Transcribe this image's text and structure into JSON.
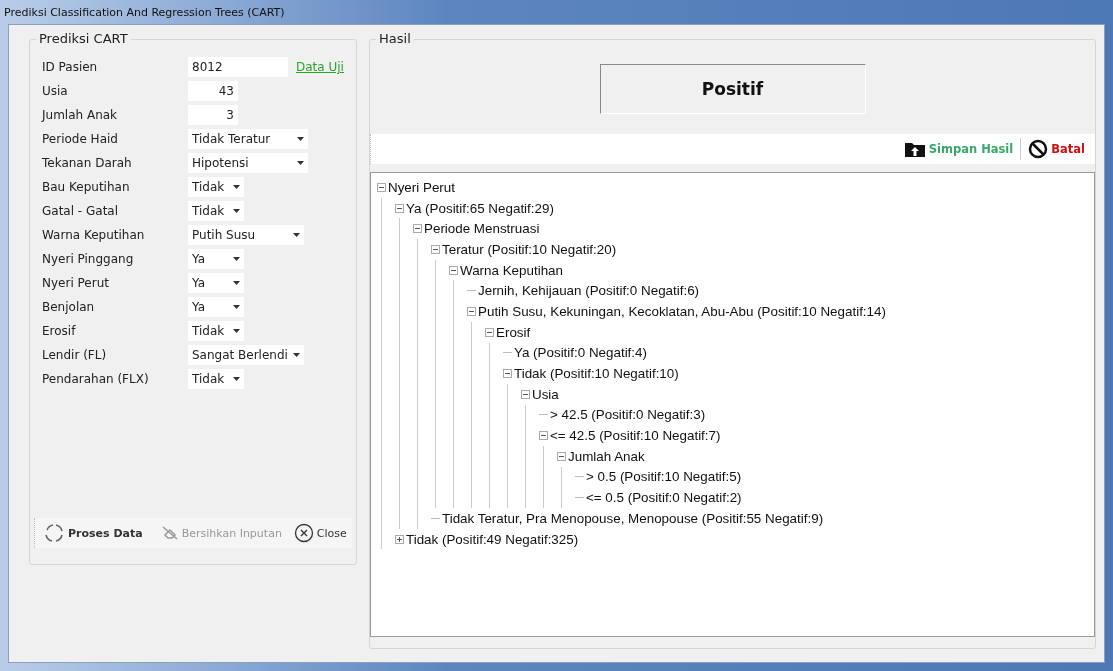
{
  "window": {
    "title": "Prediksi Classification And Regression Trees (CART)"
  },
  "form": {
    "title": "Prediksi CART",
    "fields": [
      {
        "label": "ID Pasien",
        "kind": "text",
        "value": "8012",
        "link": "Data Uji"
      },
      {
        "label": "Usia",
        "kind": "number",
        "value": "43"
      },
      {
        "label": "Jumlah Anak",
        "kind": "number",
        "value": "3"
      },
      {
        "label": "Periode Haid",
        "kind": "dropdown",
        "value": "Tidak Teratur"
      },
      {
        "label": "Tekanan Darah",
        "kind": "dropdown",
        "value": "Hipotensi"
      },
      {
        "label": "Bau Keputihan",
        "kind": "dropdown",
        "value": "Tidak"
      },
      {
        "label": "Gatal - Gatal",
        "kind": "dropdown",
        "value": "Tidak"
      },
      {
        "label": "Warna Keputihan",
        "kind": "dropdown",
        "value": "Putih Susu"
      },
      {
        "label": "Nyeri Pinggang",
        "kind": "dropdown",
        "value": "Ya"
      },
      {
        "label": "Nyeri Perut",
        "kind": "dropdown",
        "value": "Ya"
      },
      {
        "label": "Benjolan",
        "kind": "dropdown",
        "value": "Ya"
      },
      {
        "label": "Erosif",
        "kind": "dropdown",
        "value": "Tidak"
      },
      {
        "label": "Lendir (FL)",
        "kind": "dropdown",
        "value": "Sangat Berlendi"
      },
      {
        "label": "Pendarahan (FLX)",
        "kind": "dropdown",
        "value": "Tidak"
      }
    ],
    "buttons": [
      {
        "label": "Proses Data",
        "kind": "process",
        "disabled": false
      },
      {
        "label": "Bersihkan Inputan",
        "kind": "clear",
        "disabled": true
      },
      {
        "label": "Close",
        "kind": "close",
        "disabled": false
      }
    ]
  },
  "result": {
    "title": "Hasil",
    "value": "Positif",
    "buttons": [
      {
        "label": "Simpan Hasil",
        "kind": "save"
      },
      {
        "label": "Batal",
        "kind": "cancel"
      }
    ],
    "tree": [
      {
        "label": "Nyeri Perut",
        "expanded": true,
        "children": [
          {
            "label": "Ya (Positif:65 Negatif:29)",
            "expanded": true,
            "children": [
              {
                "label": "Periode Menstruasi",
                "expanded": true,
                "children": [
                  {
                    "label": "Teratur (Positif:10 Negatif:20)",
                    "expanded": true,
                    "children": [
                      {
                        "label": "Warna Keputihan",
                        "expanded": true,
                        "children": [
                          {
                            "label": "Jernih, Kehijauan (Positif:0 Negatif:6)"
                          },
                          {
                            "label": "Putih Susu, Kekuningan, Kecoklatan, Abu-Abu (Positif:10 Negatif:14)",
                            "expanded": true,
                            "children": [
                              {
                                "label": "Erosif",
                                "expanded": true,
                                "children": [
                                  {
                                    "label": "Ya (Positif:0 Negatif:4)"
                                  },
                                  {
                                    "label": "Tidak (Positif:10 Negatif:10)",
                                    "expanded": true,
                                    "children": [
                                      {
                                        "label": "Usia",
                                        "expanded": true,
                                        "children": [
                                          {
                                            "label": "> 42.5 (Positif:0 Negatif:3)"
                                          },
                                          {
                                            "label": "<= 42.5 (Positif:10 Negatif:7)",
                                            "expanded": true,
                                            "children": [
                                              {
                                                "label": "Jumlah Anak",
                                                "expanded": true,
                                                "children": [
                                                  {
                                                    "label": "> 0.5 (Positif:10 Negatif:5)"
                                                  },
                                                  {
                                                    "label": "<= 0.5 (Positif:0 Negatif:2)"
                                                  }
                                                ]
                                              }
                                            ]
                                          }
                                        ]
                                      }
                                    ]
                                  }
                                ]
                              }
                            ]
                          }
                        ]
                      }
                    ]
                  },
                  {
                    "label": "Tidak Teratur, Pra Menopouse, Menopouse (Positif:55 Negatif:9)"
                  }
                ]
              }
            ]
          },
          {
            "label": "Tidak (Positif:49 Negatif:325)",
            "expanded": false
          }
        ]
      }
    ]
  }
}
